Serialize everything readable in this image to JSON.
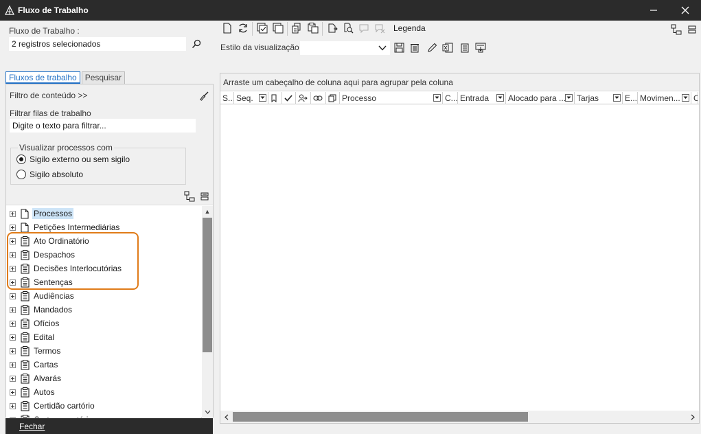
{
  "window": {
    "title": "Fluxo de Trabalho",
    "minimize": "—",
    "close": "✕"
  },
  "left": {
    "workflow_label": "Fluxo de Trabalho :",
    "workflow_value": "2 registros selecionados",
    "tabs": [
      "Fluxos de trabalho",
      "Pesquisar"
    ],
    "content_filter": "Filtro de conteúdo >>",
    "filter_queues_label": "Filtrar filas de trabalho",
    "filter_placeholder": "Digite o texto para filtrar...",
    "view_group_label": "Visualizar processos com",
    "radio_options": [
      {
        "label": "Sigilo externo ou sem sigilo",
        "checked": true
      },
      {
        "label": "Sigilo absoluto",
        "checked": false
      }
    ],
    "tree_items": [
      {
        "label": "Processos",
        "icon": "document-icon",
        "selected": true
      },
      {
        "label": "Petições Intermediárias",
        "icon": "document-icon"
      },
      {
        "label": "Ato Ordinatório",
        "icon": "clipboard-icon"
      },
      {
        "label": "Despachos",
        "icon": "clipboard-icon"
      },
      {
        "label": "Decisões Interlocutórias",
        "icon": "clipboard-icon"
      },
      {
        "label": "Sentenças",
        "icon": "clipboard-icon"
      },
      {
        "label": "Audiências",
        "icon": "clipboard-icon"
      },
      {
        "label": "Mandados",
        "icon": "clipboard-icon"
      },
      {
        "label": "Ofícios",
        "icon": "clipboard-icon"
      },
      {
        "label": "Edital",
        "icon": "clipboard-icon"
      },
      {
        "label": "Termos",
        "icon": "clipboard-icon"
      },
      {
        "label": "Cartas",
        "icon": "clipboard-icon"
      },
      {
        "label": "Alvarás",
        "icon": "clipboard-icon"
      },
      {
        "label": "Autos",
        "icon": "clipboard-icon"
      },
      {
        "label": "Certidão cartório",
        "icon": "clipboard-icon"
      },
      {
        "label": "Carta precatória",
        "icon": "clipboard-icon"
      }
    ],
    "close_button": "Fechar"
  },
  "right": {
    "legend_label": "Legenda",
    "view_style_label": "Estilo da visualização",
    "view_style_value": "",
    "group_hint": "Arraste um cabeçalho de coluna aqui para agrupar pela coluna",
    "columns": [
      "S...",
      "Seq.",
      "",
      "",
      "",
      "",
      "",
      "Processo",
      "C...",
      "Entrada",
      "Alocado para ...",
      "Tarjas",
      "E...",
      "Movimen...",
      "C"
    ]
  },
  "colors": {
    "titlebar": "#2b2b2b",
    "accent": "#1f6fc5",
    "highlight": "#e07b18",
    "selected_bg": "#cde4f7"
  }
}
